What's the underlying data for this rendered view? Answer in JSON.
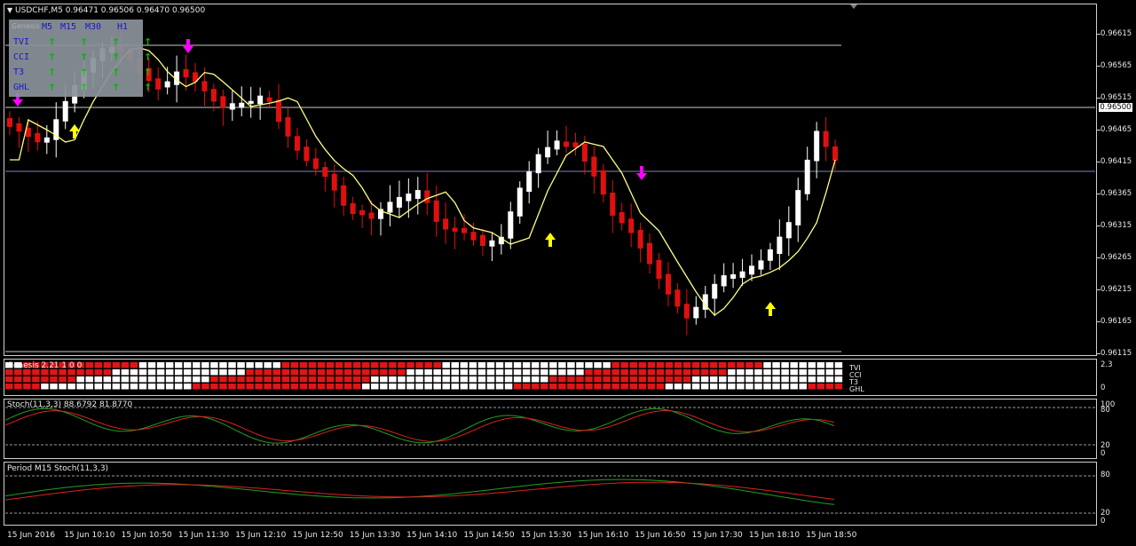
{
  "symbol_header": {
    "title": "USDCHF,M5",
    "ohlc": "0.96471 0.96506 0.96470 0.96500"
  },
  "price_axis": {
    "labels": [
      "0.96615",
      "0.96565",
      "0.96515",
      "0.96465",
      "0.96415",
      "0.96365",
      "0.96315",
      "0.96265",
      "0.96215",
      "0.96165",
      "0.96115"
    ],
    "current_price": "0.96500"
  },
  "indicator_table": {
    "name": "Genesis",
    "timeframes": [
      "M5",
      "M15",
      "M30",
      "H1"
    ],
    "rows": [
      {
        "label": "TVI",
        "arrows": [
          "up",
          "up",
          "up",
          "up"
        ]
      },
      {
        "label": "CCI",
        "arrows": [
          "up",
          "up",
          "up",
          "up"
        ]
      },
      {
        "label": "T3",
        "arrows": [
          "up",
          "up",
          "up",
          "up"
        ]
      },
      {
        "label": "GHL",
        "arrows": [
          "up",
          "up",
          "up",
          "up"
        ]
      }
    ],
    "up_glyph": "↑",
    "down_glyph": "↓"
  },
  "genesis_pane": {
    "title": "Genesis 2.21 1 0 0",
    "row_labels": [
      "TVI",
      "CCI",
      "T3",
      "GHL"
    ],
    "scale_top": "2.3",
    "scale_bottom": "0"
  },
  "stoch_pane": {
    "title": "Stoch(11,3,3) 88.6792 81.8770",
    "scale": [
      "100",
      "80",
      "20",
      "0"
    ]
  },
  "period_stoch_pane": {
    "title": "Period M15 Stoch(11,3,3)",
    "scale": [
      "80",
      "20",
      "0"
    ]
  },
  "time_axis": {
    "labels": [
      "15 Jun 2016",
      "15 Jun 10:10",
      "15 Jun 10:50",
      "15 Jun 11:30",
      "15 Jun 12:10",
      "15 Jun 12:50",
      "15 Jun 13:30",
      "15 Jun 14:10",
      "15 Jun 14:50",
      "15 Jun 15:30",
      "15 Jun 16:10",
      "15 Jun 16:50",
      "15 Jun 17:30",
      "15 Jun 18:10",
      "15 Jun 18:50"
    ]
  },
  "colors": {
    "bull": "#ffffff",
    "bear": "#e01010",
    "ma_line": "#ffff80",
    "signal_up": "#ffff00",
    "signal_down": "#ff00ff",
    "stoch_main": "#20a020",
    "stoch_signal": "#e02020",
    "hline_gray": "#c8c8c8",
    "hline_blue": "#8080c0"
  }
}
